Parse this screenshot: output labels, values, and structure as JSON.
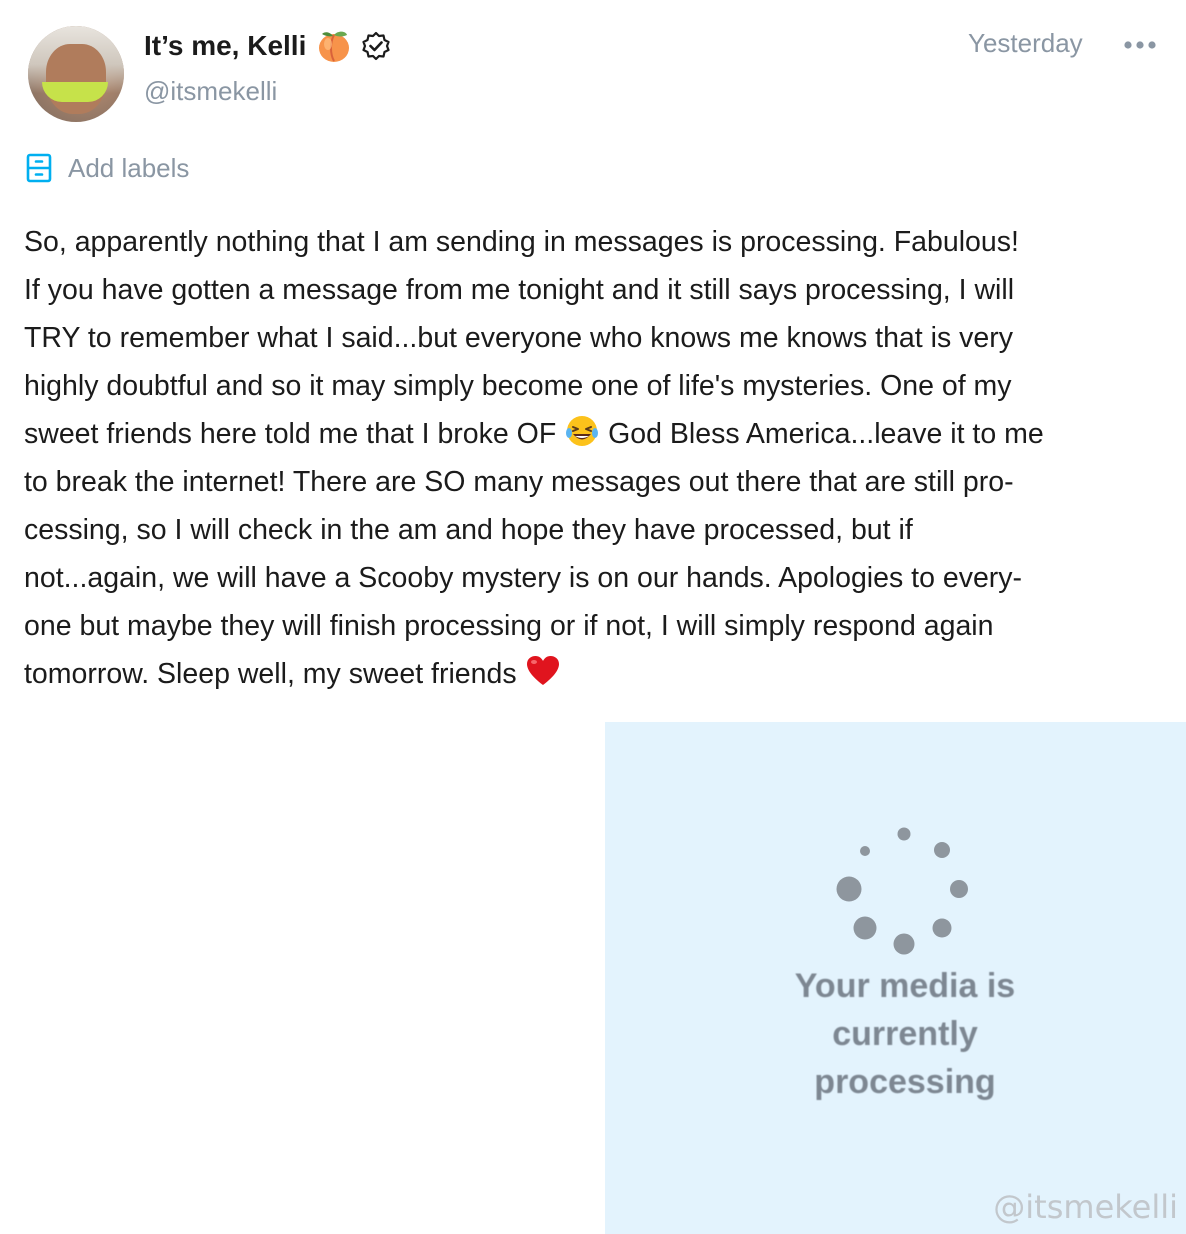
{
  "post": {
    "author": {
      "display_name": "It’s me, Kelli",
      "handle": "@itsmekelli",
      "name_emoji": "peach-icon",
      "verified_icon": "verified-badge-icon"
    },
    "timestamp": "Yesterday",
    "more_icon": "more-horizontal-icon",
    "add_labels": {
      "icon": "label-icon",
      "label": "Add labels"
    },
    "body_lines": [
      "So, apparently nothing that I am sending in messages is processing. Fabulous!",
      "If you have gotten a message from me tonight and it still says processing, I will",
      "TRY to remember what I said...but everyone who knows me knows that is very",
      "highly doubtful and so it may simply become one of life's mysteries. One of my",
      "sweet friends here told me that I broke OF",
      "God Bless America...leave it to me",
      "to break the internet! There are SO many messages out there that are still pro-",
      "cessing, so I will check in the am and hope they have processed, but if",
      "not...again, we will have a Scooby mystery is on our hands. Apologies to every-",
      "one but maybe they will finish processing or if not, I will simply respond again",
      "tomorrow. Sleep well, my sweet friends"
    ],
    "media": {
      "processing_lines": [
        "Your media is",
        "currently",
        "processing"
      ],
      "watermark": "@itsmekelli",
      "background_color": "#e3f3fd"
    }
  },
  "colors": {
    "text": "#1b1b1b",
    "muted": "#8a96a3",
    "accent": "#00aff0"
  }
}
